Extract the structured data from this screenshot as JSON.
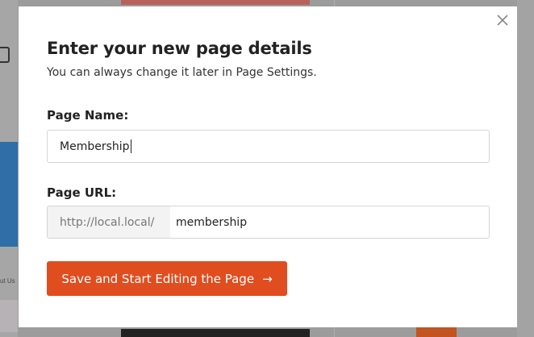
{
  "modal": {
    "title": "Enter your new page details",
    "subtitle": "You can always change it later in Page Settings.",
    "close_icon": "close-icon"
  },
  "page_name": {
    "label": "Page Name:",
    "value": "Membership"
  },
  "page_url": {
    "label": "Page URL:",
    "prefix": "http://local.local/",
    "value": "membership"
  },
  "save_button": {
    "label": "Save and Start Editing the Page",
    "icon": "arrow-right-icon",
    "arrow": "→"
  },
  "background": {
    "text": "ut Us"
  },
  "colors": {
    "accent": "#e04d1f",
    "overlay": "#9c9c9c"
  }
}
